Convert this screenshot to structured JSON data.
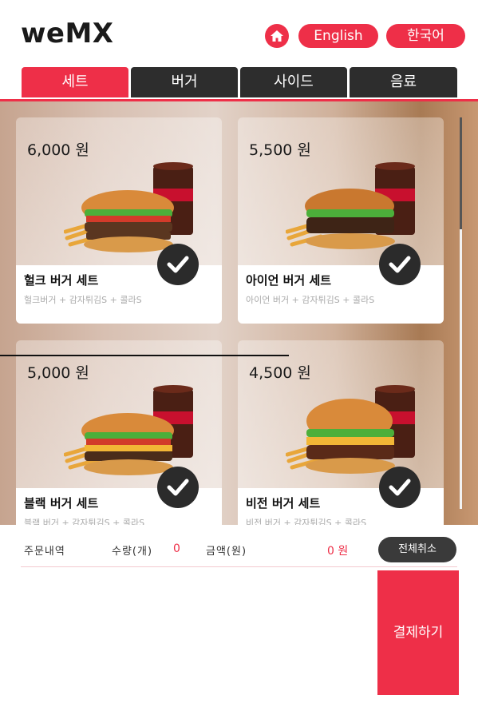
{
  "header": {
    "logo": "weMX",
    "home_icon": "home-icon",
    "lang_english": "English",
    "lang_korean": "한국어"
  },
  "tabs": [
    {
      "label": "세트",
      "active": true
    },
    {
      "label": "버거",
      "active": false
    },
    {
      "label": "사이드",
      "active": false
    },
    {
      "label": "음료",
      "active": false
    }
  ],
  "menu": {
    "items": [
      {
        "price": "6,000 원",
        "name": "헐크 버거 세트",
        "desc": "헐크버거 + 감자튀김S + 콜라S"
      },
      {
        "price": "5,500 원",
        "name": "아이언 버거 세트",
        "desc": "아이언 버거 + 감자튀김S + 콜라S"
      },
      {
        "price": "5,000 원",
        "name": "블랙 버거 세트",
        "desc": "블랙 버거 + 감자튀김S + 콜라S"
      },
      {
        "price": "4,500 원",
        "name": "비전 버거 세트",
        "desc": "비전 버거 + 감자튀김S + 콜라S"
      }
    ]
  },
  "order": {
    "label": "주문내역",
    "qty_label": "수량(개)",
    "qty_value": "0",
    "amount_label": "금액(원)",
    "amount_value": "0 원",
    "cancel_all": "전체취소",
    "pay": "결제하기"
  },
  "colors": {
    "accent": "#ee2f48",
    "dark": "#2d2d2d"
  }
}
